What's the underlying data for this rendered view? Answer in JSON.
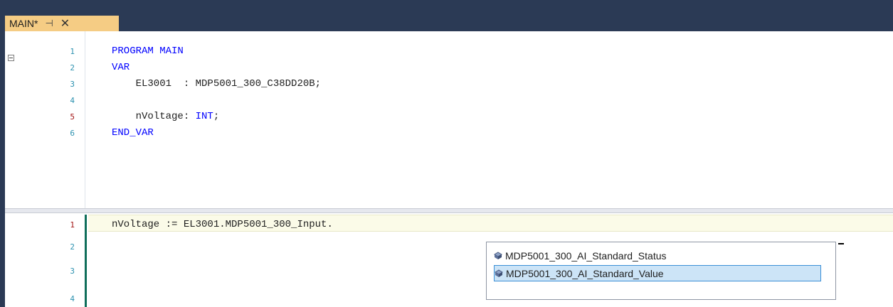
{
  "tab": {
    "title": "MAIN*",
    "pin_icon": "pin-icon",
    "close_icon": "close-icon"
  },
  "declaration": {
    "line_numbers": [
      "1",
      "2",
      "3",
      "4",
      "5",
      "6"
    ],
    "lines": {
      "l1": "PROGRAM MAIN",
      "l2": "VAR",
      "l3": "    EL3001  : MDP5001_300_C38DD20B;",
      "l4": "",
      "l5_a": "    nVoltage: ",
      "l5_b": "INT",
      "l5_c": ";",
      "l6": "END_VAR"
    }
  },
  "implementation": {
    "line_numbers": [
      "1",
      "2",
      "3",
      "4"
    ],
    "lines": {
      "l1": "nVoltage := EL3001.MDP5001_300_Input."
    }
  },
  "autocomplete": {
    "items": [
      {
        "label": "MDP5001_300_AI_Standard_Status",
        "icon": "struct-member-icon",
        "selected": false
      },
      {
        "label": "MDP5001_300_AI_Standard_Value",
        "icon": "struct-member-icon",
        "selected": true
      }
    ]
  },
  "colors": {
    "keyword": "#0000ff",
    "tab_active": "#f5cc84",
    "background_frame": "#2b3a55",
    "selection": "#cce4f7"
  }
}
